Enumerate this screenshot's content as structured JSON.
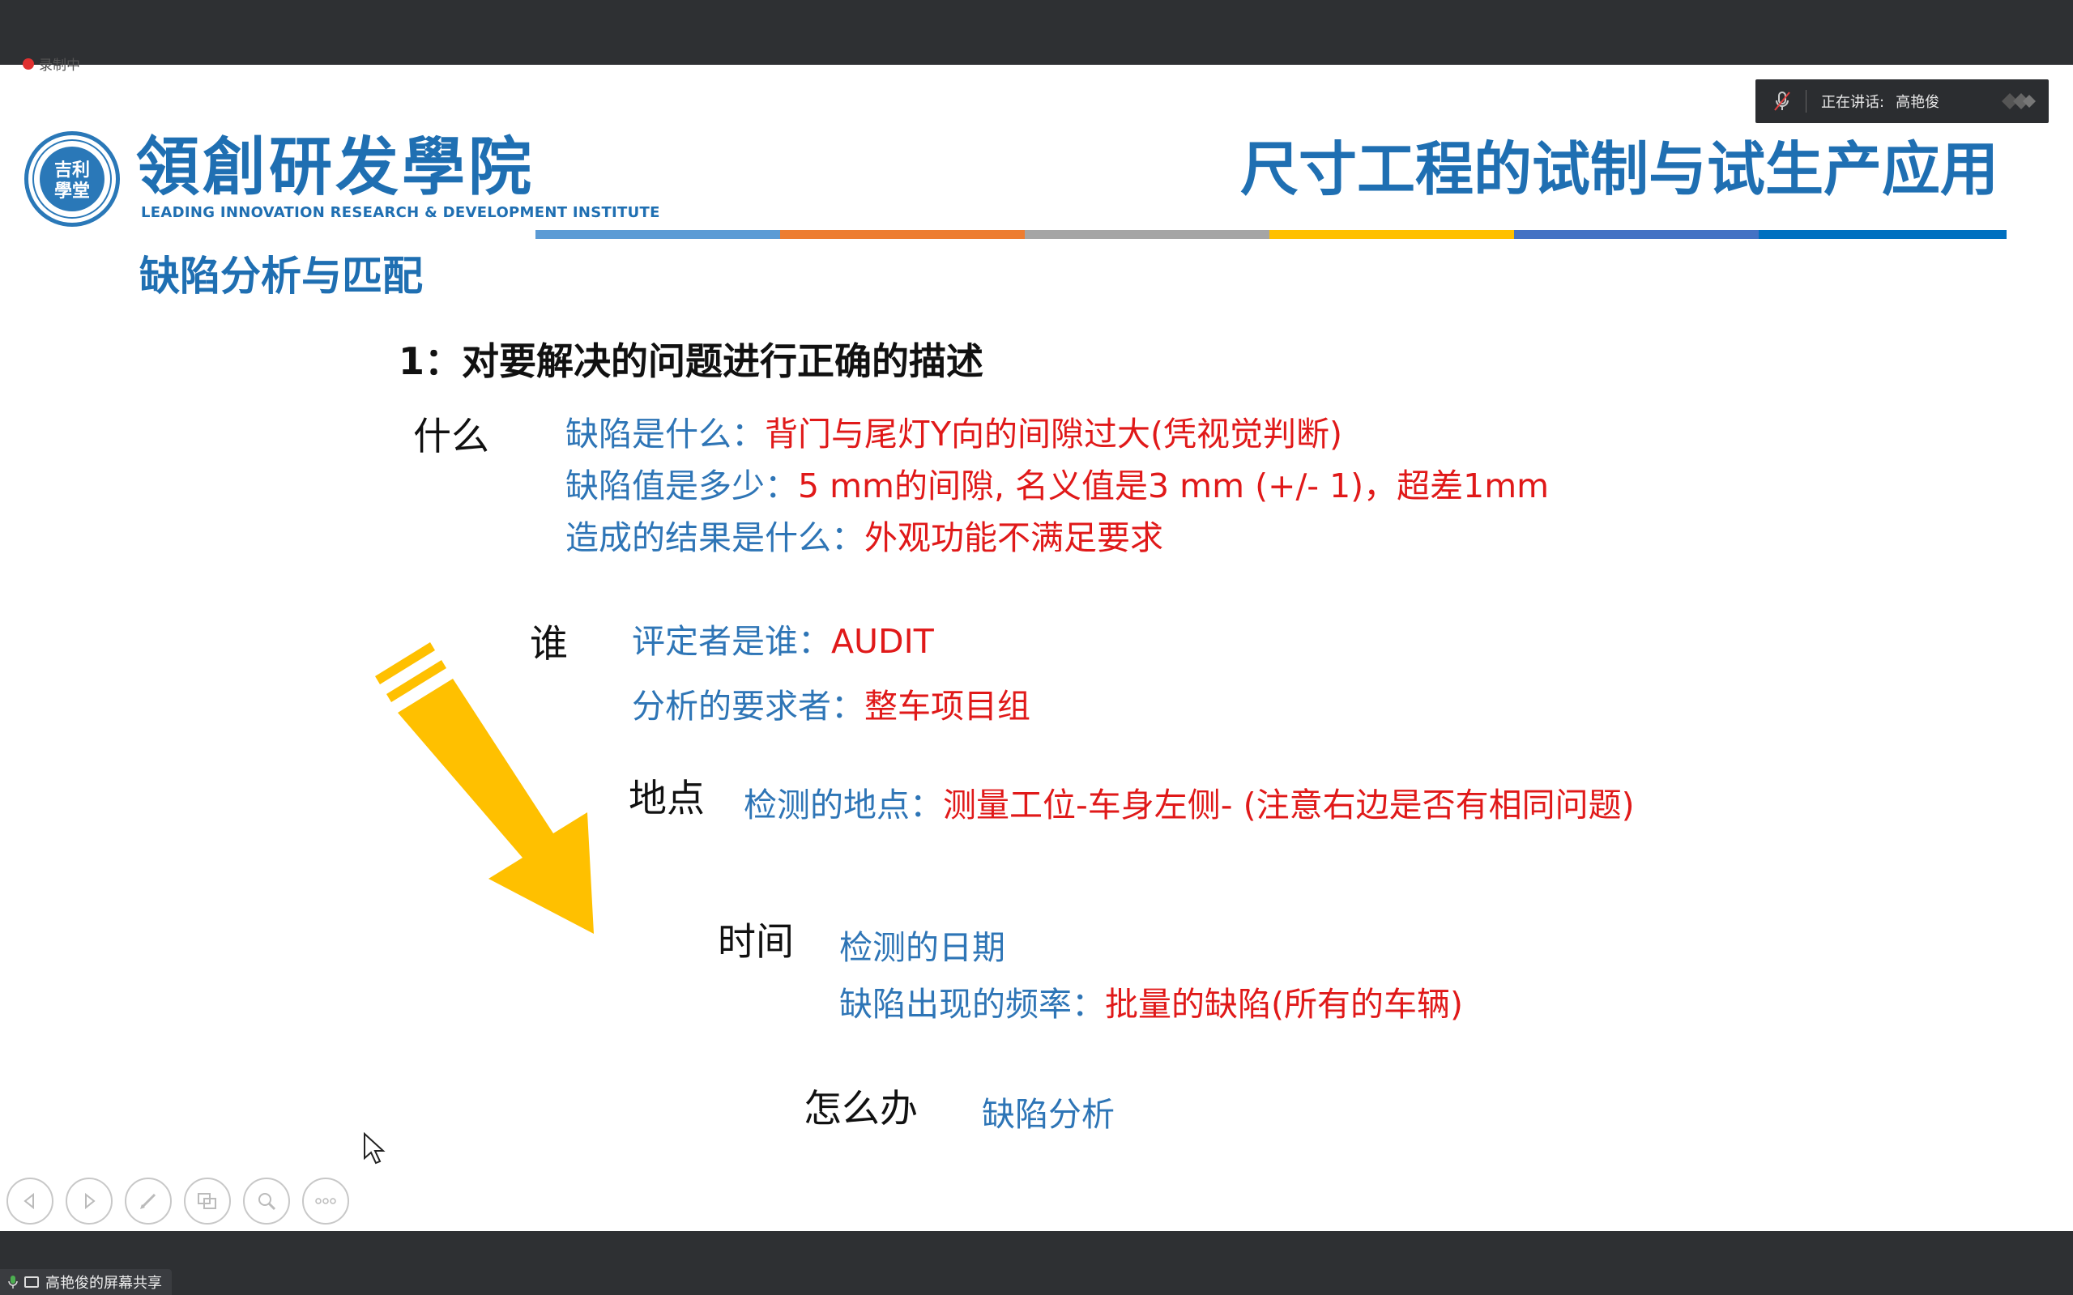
{
  "recording": {
    "label": "录制中"
  },
  "speaker": {
    "label": "正在讲话:",
    "name": "高艳俊"
  },
  "logo": {
    "name_cn": "領創研发學院",
    "name_en": "LEADING INNOVATION RESEARCH & DEVELOPMENT INSTITUTE"
  },
  "slide": {
    "title": "尺寸工程的试制与试生产应用",
    "subtitle": "缺陷分析与匹配",
    "section": "1：对要解决的问题进行正确的描述",
    "what": {
      "label": "什么",
      "lines": [
        {
          "q": "缺陷是什么：",
          "a": "背门与尾灯Y向的间隙过大(凭视觉判断)"
        },
        {
          "q": "缺陷值是多少：",
          "a": "5 mm的间隙, 名义值是3 mm (+/- 1)，超差1mm"
        },
        {
          "q": "造成的结果是什么：",
          "a": "外观功能不满足要求"
        }
      ]
    },
    "who": {
      "label": "谁",
      "lines": [
        {
          "q": "评定者是谁：",
          "a": "AUDIT"
        },
        {
          "q": "分析的要求者：",
          "a": "整车项目组"
        }
      ]
    },
    "where": {
      "label": "地点",
      "lines": [
        {
          "q": "检测的地点：",
          "a": "测量工位-车身左侧- (注意右边是否有相同问题)"
        }
      ]
    },
    "when": {
      "label": "时间",
      "lines": [
        {
          "q": "检测的日期",
          "a": ""
        },
        {
          "q": "缺陷出现的频率：",
          "a": "批量的缺陷(所有的车辆)"
        }
      ]
    },
    "how": {
      "label": "怎么办",
      "q": "缺陷分析"
    }
  },
  "toolbar": {
    "buttons": [
      "prev-icon",
      "next-icon",
      "pen-icon",
      "screen-icon",
      "zoom-icon",
      "more-icon"
    ]
  },
  "share": {
    "label": "高艳俊的屏幕共享"
  },
  "colors": {
    "accent_blue": "#1f6fb2",
    "text_blue": "#2e75b6",
    "text_red": "#e01919",
    "arrow_yellow": "#ffc000",
    "bar_dark": "#2e3033"
  }
}
